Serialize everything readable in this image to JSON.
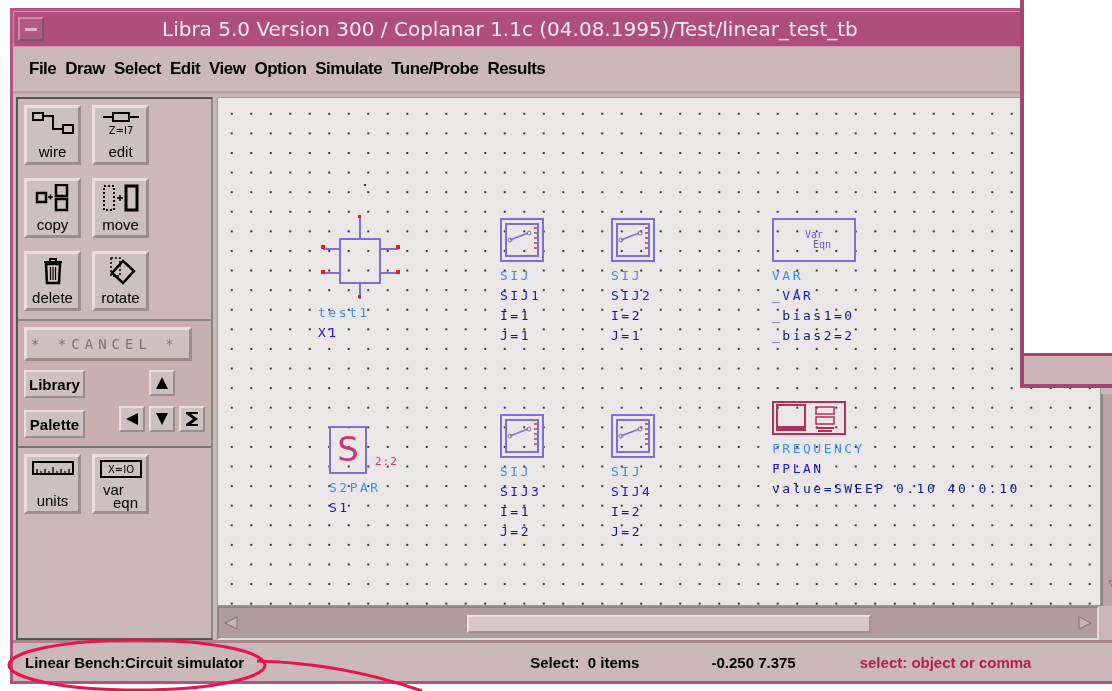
{
  "window": {
    "title": "Libra 5.0 Version 300 / Coplanar 1.1c (04.08.1995)/Test/linear_test_tb"
  },
  "menu": [
    "File",
    "Draw",
    "Select",
    "Edit",
    "View",
    "Option",
    "Simulate",
    "Tune/Probe",
    "Results"
  ],
  "tools": [
    {
      "kind": "wire",
      "label": "wire"
    },
    {
      "kind": "edit",
      "label": "edit"
    },
    {
      "kind": "copy",
      "label": "copy"
    },
    {
      "kind": "move",
      "label": "move"
    },
    {
      "kind": "delete",
      "label": "delete"
    },
    {
      "kind": "rotate",
      "label": "rotate"
    }
  ],
  "tool_icon_texts": {
    "edit": "Z=I7"
  },
  "palette": {
    "cancel": "* *CANCEL *",
    "buttons": [
      "Library",
      "Palette"
    ],
    "arrows": [
      {
        "kind": "up"
      },
      {
        "kind": "left"
      },
      {
        "kind": "down"
      },
      {
        "kind": "end"
      }
    ]
  },
  "tools2": [
    {
      "kind": "units",
      "label": "units"
    },
    {
      "kind": "vareqn",
      "label": [
        "var",
        "eqn"
      ],
      "icon_text": "X=IO"
    }
  ],
  "canvas": {
    "components": [
      {
        "kind": "subcircuit",
        "labels": [
          "test1",
          "X1"
        ]
      },
      {
        "kind": "sij",
        "labels": [
          "SIJ",
          "SIJ1",
          "I=1",
          "J=1"
        ]
      },
      {
        "kind": "sij",
        "labels": [
          "SIJ",
          "SIJ2",
          "I=2",
          "J=1"
        ]
      },
      {
        "kind": "var",
        "symbol_text": [
          "Var",
          "Eqn"
        ],
        "labels": [
          "VAR",
          "_VAR",
          "_bias1=0",
          "_bias2=2"
        ]
      },
      {
        "kind": "sparams",
        "symbol_text": [
          "S"
        ],
        "port_label": "2:2",
        "labels": [
          "S2PAR",
          "S1"
        ]
      },
      {
        "kind": "sij",
        "labels": [
          "SIJ",
          "SIJ3",
          "I=1",
          "J=2"
        ]
      },
      {
        "kind": "sij",
        "labels": [
          "SIJ",
          "SIJ4",
          "I=2",
          "J=2"
        ]
      },
      {
        "kind": "frequency",
        "labels": [
          "FREQUENCY",
          "FPLAN",
          "value=SWEEP 0.10 40 0.10"
        ]
      }
    ]
  },
  "status_bar": {
    "mode": "Linear Bench:Circuit simulator",
    "selection": "Select:  0 items",
    "coordinates": "-0.250 7.375",
    "prompt": "select: object or comma"
  }
}
